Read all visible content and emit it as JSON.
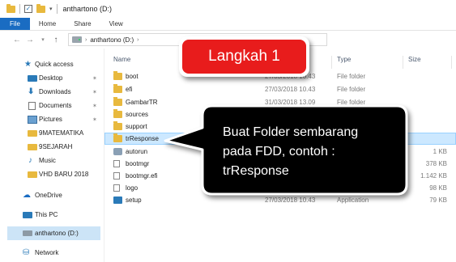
{
  "window": {
    "title": "anthartono (D:)"
  },
  "ribbon": {
    "tabs": [
      "File",
      "Home",
      "Share",
      "View"
    ]
  },
  "address": {
    "path": [
      "anthartono (D:)"
    ]
  },
  "nav": {
    "items": [
      {
        "label": "Quick access",
        "icon": "star-icon",
        "pinned": false
      },
      {
        "label": "Desktop",
        "icon": "desktop-icon",
        "pinned": true
      },
      {
        "label": "Downloads",
        "icon": "download-icon",
        "pinned": true
      },
      {
        "label": "Documents",
        "icon": "document-icon",
        "pinned": true
      },
      {
        "label": "Pictures",
        "icon": "pictures-icon",
        "pinned": true
      },
      {
        "label": "9MATEMATIKA",
        "icon": "folder-icon",
        "pinned": false
      },
      {
        "label": "9SEJARAH",
        "icon": "folder-icon",
        "pinned": false
      },
      {
        "label": "Music",
        "icon": "music-icon",
        "pinned": false
      },
      {
        "label": "VHD BARU 2018",
        "icon": "folder-icon",
        "pinned": false
      },
      {
        "label": "OneDrive",
        "icon": "cloud-icon",
        "pinned": false
      },
      {
        "label": "This PC",
        "icon": "computer-icon",
        "pinned": false
      },
      {
        "label": "anthartono (D:)",
        "icon": "drive-icon",
        "pinned": false
      },
      {
        "label": "Network",
        "icon": "network-icon",
        "pinned": false
      }
    ],
    "pin_glyph": "★"
  },
  "columns": {
    "name": "Name",
    "date": "",
    "type": "Type",
    "size": "Size"
  },
  "files": [
    {
      "name": "boot",
      "date": "27/03/2018 10.43",
      "type": "File folder",
      "size": "",
      "icon": "folder-icon"
    },
    {
      "name": "efi",
      "date": "27/03/2018 10.43",
      "type": "File folder",
      "size": "",
      "icon": "folder-icon"
    },
    {
      "name": "GambarTR",
      "date": "31/03/2018 13.09",
      "type": "File folder",
      "size": "",
      "icon": "folder-icon"
    },
    {
      "name": "sources",
      "date": "",
      "type": "",
      "size": "",
      "icon": "folder-icon"
    },
    {
      "name": "support",
      "date": "",
      "type": "",
      "size": "",
      "icon": "folder-icon"
    },
    {
      "name": "trResponse",
      "date": "",
      "type": "",
      "size": "",
      "icon": "folder-icon"
    },
    {
      "name": "autorun",
      "date": "",
      "type": "",
      "size": "1 KB",
      "icon": "settings-file-icon"
    },
    {
      "name": "bootmgr",
      "date": "",
      "type": "",
      "size": "378 KB",
      "icon": "file-icon"
    },
    {
      "name": "bootmgr.efi",
      "date": "",
      "type": "",
      "size": "1.142 KB",
      "icon": "file-icon"
    },
    {
      "name": "logo",
      "date": "",
      "type": "",
      "size": "98 KB",
      "icon": "image-file-icon"
    },
    {
      "name": "setup",
      "date": "27/03/2018 10.43",
      "type": "Application",
      "size": "79 KB",
      "icon": "setup-icon"
    }
  ],
  "callouts": {
    "step": "Langkah 1",
    "instruction": "Buat Folder sembarang\npada FDD, contoh :\ntrResponse"
  },
  "colors": {
    "accent": "#1a6cc2",
    "step_red": "#e81c1c",
    "bubble_black": "#000000",
    "folder": "#e8b93e",
    "selection": "#cce8ff"
  }
}
